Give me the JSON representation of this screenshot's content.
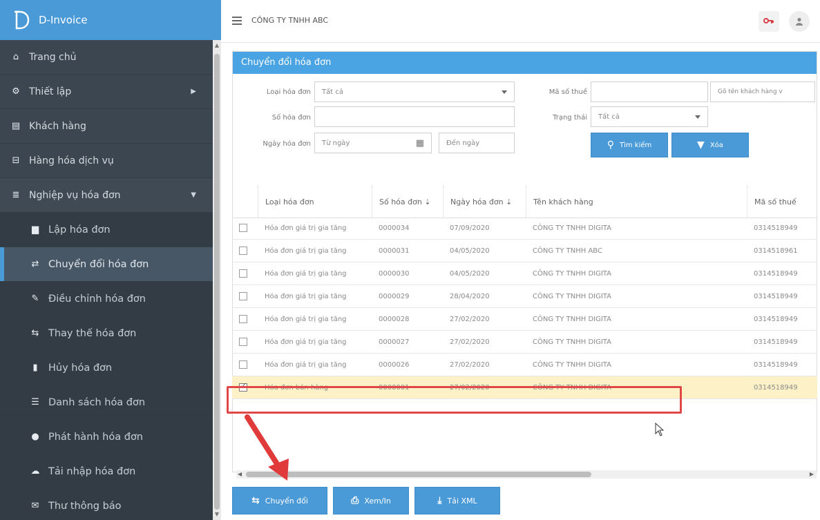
{
  "brand": {
    "name": "D-Invoice"
  },
  "sidebar": {
    "items": [
      {
        "label": "Trang chủ",
        "icon": "home-icon"
      },
      {
        "label": "Thiết lập",
        "icon": "cogs-icon"
      },
      {
        "label": "Khách hàng",
        "icon": "id-card-icon"
      },
      {
        "label": "Hàng hóa dịch vụ",
        "icon": "basket-icon"
      },
      {
        "label": "Nghiệp vụ hóa đơn",
        "icon": "list-icon"
      },
      {
        "label": "Lập hóa đơn",
        "icon": "file-icon"
      },
      {
        "label": "Chuyển đổi hóa đơn",
        "icon": "exchange-icon"
      },
      {
        "label": "Điều chỉnh hóa đơn",
        "icon": "edit-icon"
      },
      {
        "label": "Thay thế hóa đơn",
        "icon": "retweet-icon"
      },
      {
        "label": "Hủy hóa đơn",
        "icon": "trash-icon"
      },
      {
        "label": "Danh sách hóa đơn",
        "icon": "list-icon"
      },
      {
        "label": "Phát hành hóa đơn",
        "icon": "circle-icon"
      },
      {
        "label": "Tải nhập hóa đơn",
        "icon": "cloud-upload-icon"
      },
      {
        "label": "Thư thông báo",
        "icon": "envelope-icon"
      }
    ]
  },
  "topbar": {
    "company": "CÔNG TY TNHH ABC"
  },
  "panel": {
    "title": "Chuyển đổi hóa đơn"
  },
  "filters": {
    "invoice_type_label": "Loại hóa đơn",
    "invoice_type_value": "Tất cả",
    "invoice_no_label": "Số hóa đơn",
    "invoice_date_label": "Ngày hóa đơn",
    "from_date_placeholder": "Từ ngày",
    "to_date_placeholder": "Đến ngày",
    "tax_code_label": "Mã số thuế",
    "customer_placeholder": "Gõ tên khách hàng v",
    "status_label": "Trạng thái",
    "status_value": "Tất cả",
    "search_button": "Tìm kiếm",
    "clear_button": "Xóa"
  },
  "table": {
    "headers": [
      "Loại hóa đơn",
      "Số hóa đơn",
      "Ngày hóa đơn",
      "Tên khách hàng",
      "Mã số thuế"
    ],
    "rows": [
      {
        "type": "Hóa đơn giá trị gia tăng",
        "no": "0000034",
        "date": "07/09/2020",
        "customer": "CÔNG TY TNHH DIGITA",
        "tax": "0314518949",
        "checked": false
      },
      {
        "type": "Hóa đơn giá trị gia tăng",
        "no": "0000031",
        "date": "04/05/2020",
        "customer": "CÔNG TY TNHH ABC",
        "tax": "0314518961",
        "checked": false
      },
      {
        "type": "Hóa đơn giá trị gia tăng",
        "no": "0000030",
        "date": "04/05/2020",
        "customer": "CÔNG TY TNHH DIGITA",
        "tax": "0314518949",
        "checked": false
      },
      {
        "type": "Hóa đơn giá trị gia tăng",
        "no": "0000029",
        "date": "28/04/2020",
        "customer": "CÔNG TY TNHH DIGITA",
        "tax": "0314518949",
        "checked": false
      },
      {
        "type": "Hóa đơn giá trị gia tăng",
        "no": "0000028",
        "date": "27/02/2020",
        "customer": "CÔNG TY TNHH DIGITA",
        "tax": "0314518949",
        "checked": false
      },
      {
        "type": "Hóa đơn giá trị gia tăng",
        "no": "0000027",
        "date": "27/02/2020",
        "customer": "CÔNG TY TNHH DIGITA",
        "tax": "0314518949",
        "checked": false
      },
      {
        "type": "Hóa đơn giá trị gia tăng",
        "no": "0000026",
        "date": "27/02/2020",
        "customer": "CÔNG TY TNHH DIGITA",
        "tax": "0314518949",
        "checked": false
      },
      {
        "type": "Hóa đơn bán hàng",
        "no": "0000001",
        "date": "27/02/2020",
        "customer": "CÔNG TY TNHH DIGITA",
        "tax": "0314518949",
        "checked": true
      }
    ]
  },
  "actions": {
    "convert": "Chuyển đổi",
    "view_print": "Xem/In",
    "download_xml": "Tải XML"
  },
  "colors": {
    "accent": "#4a9ad8",
    "sidebar": "#3b4650",
    "highlight_border": "#e04848",
    "selected_row": "#fdf2c7"
  }
}
